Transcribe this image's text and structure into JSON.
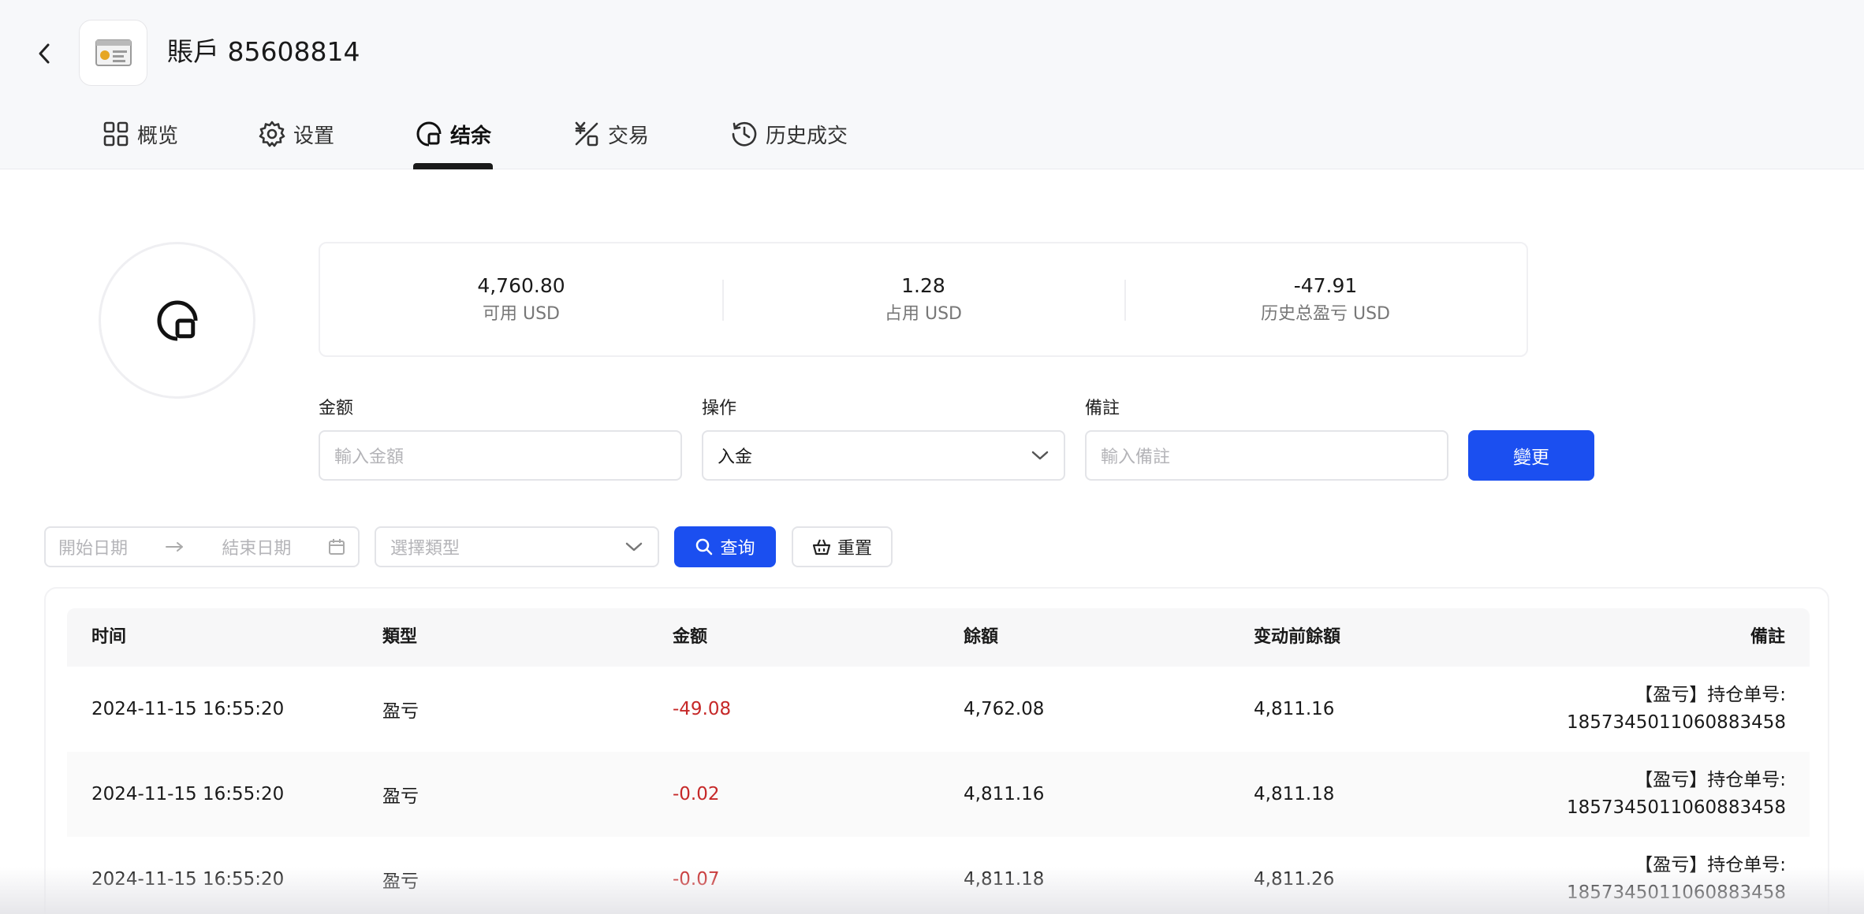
{
  "header": {
    "title": "賬戶 85608814"
  },
  "tabs": [
    {
      "label": "概览",
      "icon": "grid-icon"
    },
    {
      "label": "设置",
      "icon": "gear-icon"
    },
    {
      "label": "结余",
      "icon": "balance-icon",
      "active": true
    },
    {
      "label": "交易",
      "icon": "exchange-icon"
    },
    {
      "label": "历史成交",
      "icon": "history-icon"
    }
  ],
  "stats": [
    {
      "value": "4,760.80",
      "label": "可用 USD"
    },
    {
      "value": "1.28",
      "label": "占用 USD"
    },
    {
      "value": "-47.91",
      "label": "历史总盈亏 USD"
    }
  ],
  "form": {
    "amount_label": "金额",
    "amount_placeholder": "輸入金額",
    "operation_label": "操作",
    "operation_value": "入金",
    "remark_label": "備註",
    "remark_placeholder": "輸入備註",
    "submit_label": "變更"
  },
  "filters": {
    "start_placeholder": "開始日期",
    "end_placeholder": "結束日期",
    "type_placeholder": "選擇類型",
    "query_label": "查询",
    "reset_label": "重置"
  },
  "table": {
    "headers": [
      "时间",
      "類型",
      "金额",
      "餘額",
      "变动前餘額",
      "備註"
    ],
    "rows": [
      {
        "time": "2024-11-15 16:55:20",
        "type": "盈亏",
        "amount": "-49.08",
        "balance": "4,762.08",
        "before": "4,811.16",
        "remark_1": "【盈亏】持仓单号:",
        "remark_2": "1857345011060883458"
      },
      {
        "time": "2024-11-15 16:55:20",
        "type": "盈亏",
        "amount": "-0.02",
        "balance": "4,811.16",
        "before": "4,811.18",
        "remark_1": "【盈亏】持仓单号:",
        "remark_2": "1857345011060883458"
      },
      {
        "time": "2024-11-15 16:55:20",
        "type": "盈亏",
        "amount": "-0.07",
        "balance": "4,811.18",
        "before": "4,811.26",
        "remark_1": "【盈亏】持仓单号:",
        "remark_2": "1857345011060883458"
      }
    ]
  },
  "colors": {
    "primary": "#1b4ff0",
    "negative": "#c62828",
    "header_bg": "#f7f8fa"
  }
}
